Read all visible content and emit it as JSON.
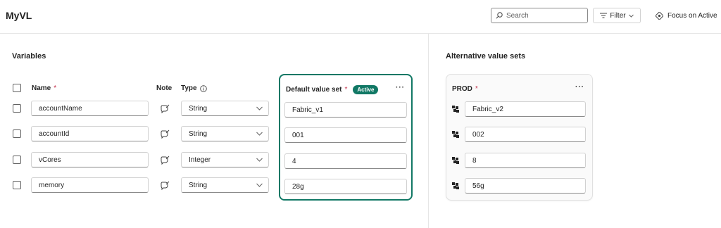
{
  "header": {
    "title": "MyVL",
    "search_placeholder": "Search",
    "filter_label": "Filter",
    "focus_label": "Focus on Active"
  },
  "variables": {
    "section_title": "Variables",
    "columns": {
      "name": "Name",
      "note": "Note",
      "type": "Type"
    },
    "required_mark": "*",
    "rows": [
      {
        "name": "accountName",
        "type": "String"
      },
      {
        "name": "accountId",
        "type": "String"
      },
      {
        "name": "vCores",
        "type": "Integer"
      },
      {
        "name": "memory",
        "type": "String"
      }
    ]
  },
  "default_set": {
    "title": "Default value set",
    "badge": "Active",
    "more": "···",
    "values": [
      "Fabric_v1",
      "001",
      "4",
      "28g"
    ]
  },
  "alternative": {
    "section_title": "Alternative value sets",
    "set_name": "PROD",
    "more": "···",
    "values": [
      "Fabric_v2",
      "002",
      "8",
      "56g"
    ]
  },
  "colors": {
    "accent": "#117865",
    "required": "#c4314b"
  },
  "icons": [
    "search-icon",
    "filter-icon",
    "chevron-down-icon",
    "focus-icon",
    "info-icon",
    "note-icon",
    "value-set-icon"
  ]
}
